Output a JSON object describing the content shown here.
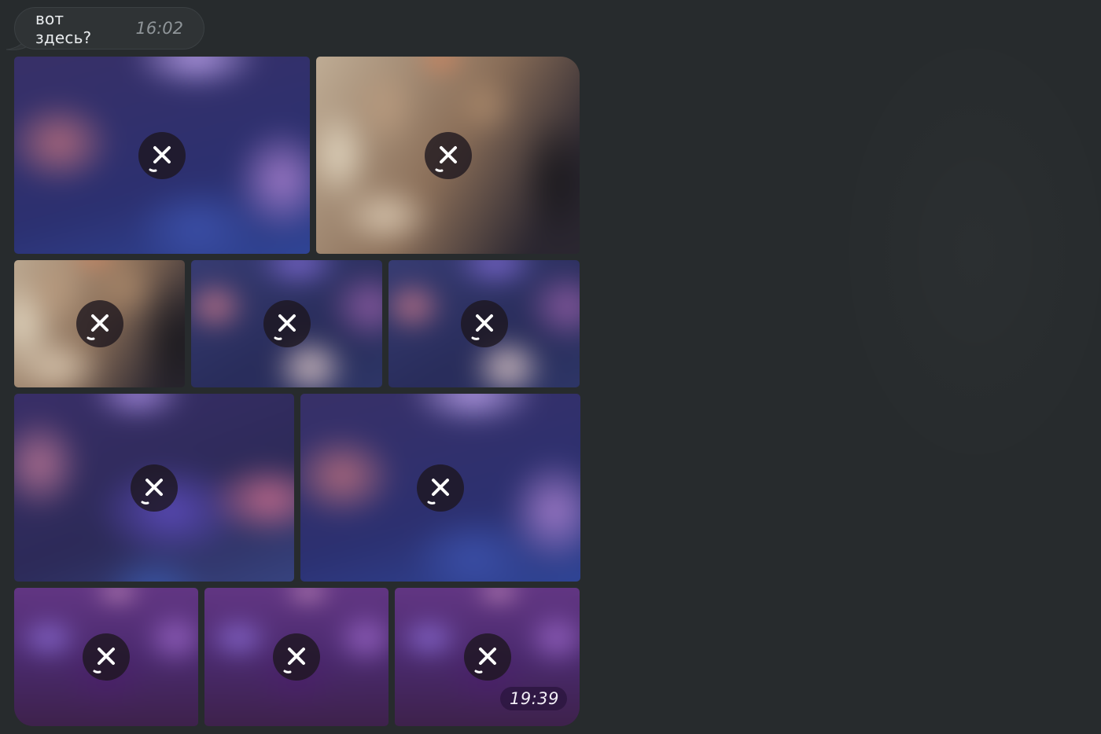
{
  "message": {
    "text": "вот здесь?",
    "time": "16:02"
  },
  "album": {
    "time": "19:39",
    "items": [
      {
        "label": "photo-1",
        "state": "cancel-download"
      },
      {
        "label": "photo-2",
        "state": "cancel-download"
      },
      {
        "label": "photo-3",
        "state": "cancel-download"
      },
      {
        "label": "photo-4",
        "state": "cancel-download"
      },
      {
        "label": "photo-5",
        "state": "cancel-download"
      },
      {
        "label": "photo-6",
        "state": "cancel-download"
      },
      {
        "label": "photo-7",
        "state": "cancel-download"
      },
      {
        "label": "photo-8",
        "state": "cancel-download"
      },
      {
        "label": "photo-9",
        "state": "cancel-download"
      },
      {
        "label": "photo-10",
        "state": "cancel-download"
      }
    ],
    "icon": "cancel-download-icon"
  },
  "colors": {
    "background": "#272b2d",
    "bubble": "#2f3335",
    "text": "#e9ecee",
    "time": "#8f9599"
  }
}
